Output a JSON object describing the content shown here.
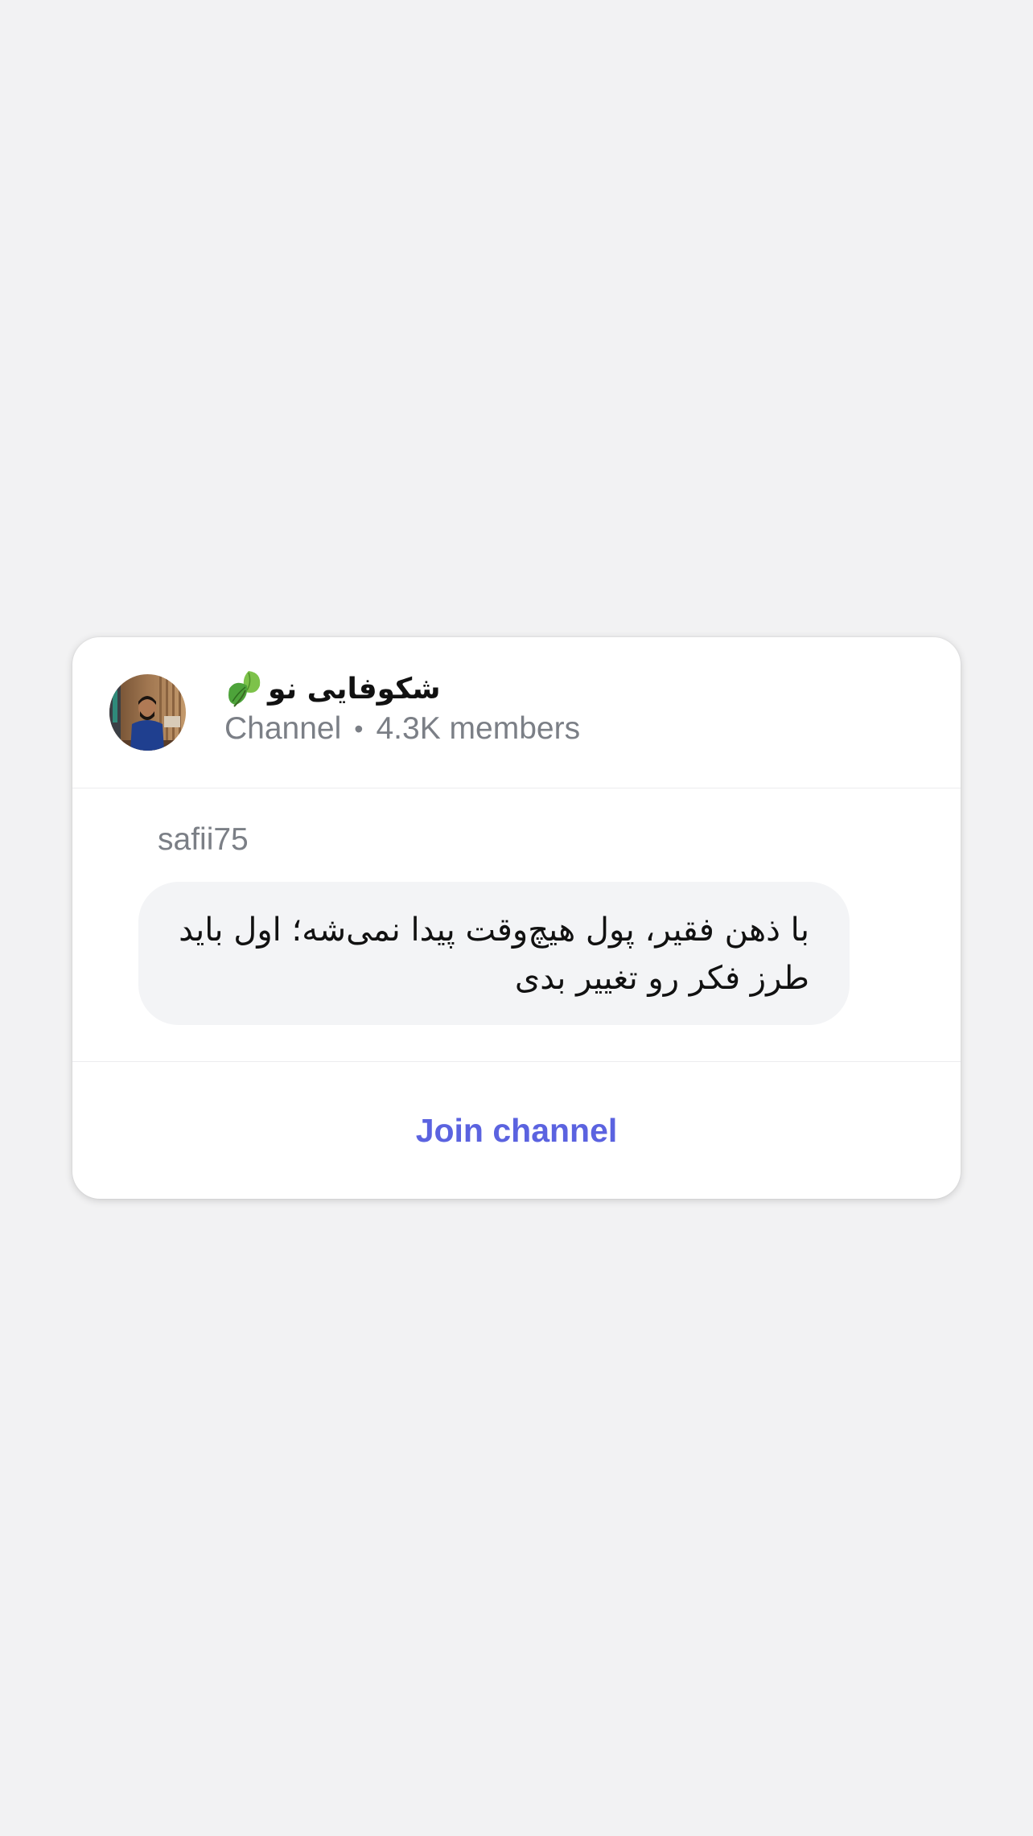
{
  "channel": {
    "title": "شکوفایی نو",
    "type_label": "Channel",
    "separator": "•",
    "members": "4.3K members"
  },
  "post": {
    "author": "safii75",
    "text": "با ذهن فقیر، پول هیچ‌وقت پیدا نمی‌شه؛ اول باید طرز فکر رو تغییر بدی"
  },
  "action": {
    "join_label": "Join channel"
  },
  "colors": {
    "background": "#f2f2f3",
    "card": "#ffffff",
    "accent": "#5b63e0",
    "muted_text": "#7b7f86",
    "bubble": "#f3f4f6"
  },
  "icons": {
    "title_emoji": "leaf-icon",
    "avatar": "channel-avatar"
  }
}
